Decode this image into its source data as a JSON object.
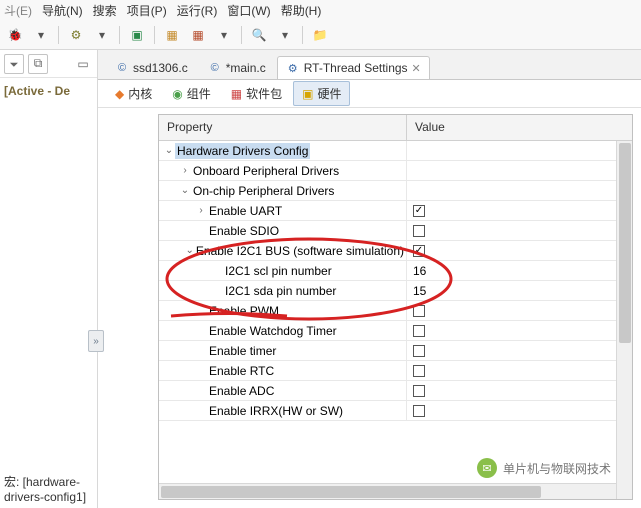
{
  "menu": {
    "nav": "导航(N)",
    "search": "搜索",
    "project": "项目(P)",
    "run": "运行(R)",
    "window": "窗口(W)",
    "help": "帮助(H)"
  },
  "left": {
    "active_de": "[Active - De",
    "status": "宏: [hardware-drivers-config1]"
  },
  "tabs": [
    {
      "label": "ssd1306.c",
      "active": false
    },
    {
      "label": "*main.c",
      "active": false
    },
    {
      "label": "RT-Thread Settings",
      "active": true
    }
  ],
  "subtabs": [
    {
      "label": "内核",
      "color": "#e67a2e"
    },
    {
      "label": "组件",
      "color": "#4aa04a"
    },
    {
      "label": "软件包",
      "color": "#cc4444"
    },
    {
      "label": "硬件",
      "color": "#d6a400",
      "active": true
    }
  ],
  "grid": {
    "col_property": "Property",
    "col_value": "Value",
    "rows": [
      {
        "indent": 0,
        "expander": "v",
        "label": "Hardware Drivers Config",
        "value": "",
        "selected": true
      },
      {
        "indent": 1,
        "expander": ">",
        "label": "Onboard Peripheral Drivers",
        "value": ""
      },
      {
        "indent": 1,
        "expander": "v",
        "label": "On-chip Peripheral Drivers",
        "value": ""
      },
      {
        "indent": 2,
        "expander": ">",
        "label": "Enable UART",
        "value": "",
        "check": true
      },
      {
        "indent": 2,
        "expander": "",
        "label": "Enable SDIO",
        "value": "",
        "check": false
      },
      {
        "indent": 2,
        "expander": "v",
        "label": "Enable I2C1 BUS (software simulation)",
        "value": "",
        "check": true
      },
      {
        "indent": 3,
        "expander": "",
        "label": "I2C1 scl pin number",
        "value": "16"
      },
      {
        "indent": 3,
        "expander": "",
        "label": "I2C1 sda pin number",
        "value": "15"
      },
      {
        "indent": 2,
        "expander": "",
        "label": "Enable PWM",
        "value": "",
        "check": false
      },
      {
        "indent": 2,
        "expander": "",
        "label": "Enable Watchdog Timer",
        "value": "",
        "check": false
      },
      {
        "indent": 2,
        "expander": "",
        "label": "Enable timer",
        "value": "",
        "check": false
      },
      {
        "indent": 2,
        "expander": "",
        "label": "Enable RTC",
        "value": "",
        "check": false
      },
      {
        "indent": 2,
        "expander": "",
        "label": "Enable ADC",
        "value": "",
        "check": false
      },
      {
        "indent": 2,
        "expander": "",
        "label": "Enable IRRX(HW or SW)",
        "value": "",
        "check": false
      }
    ]
  },
  "watermark": "单片机与物联网技术"
}
